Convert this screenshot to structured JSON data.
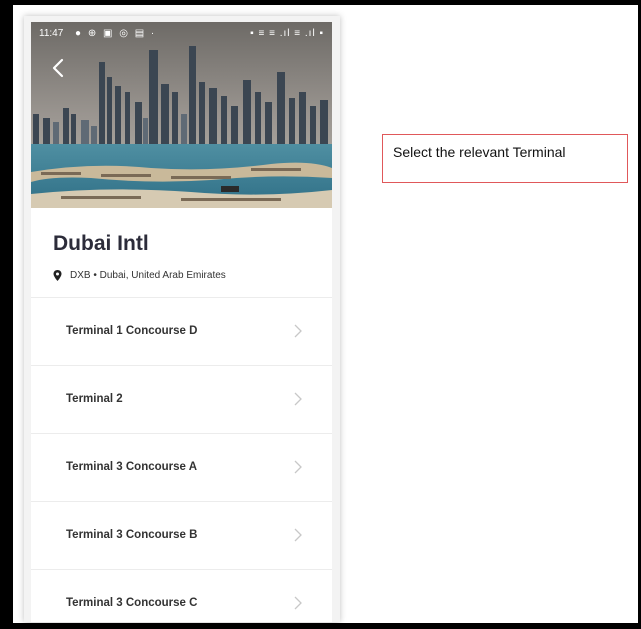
{
  "status_bar": {
    "time": "11:47",
    "left_icons": "● ⊕ ▣ ◎ ▤ ·",
    "right_icons": "▪ ≡ ≡ .ıl ≡ .ıl ▪"
  },
  "airport": {
    "name": "Dubai Intl",
    "location": "DXB • Dubai, United Arab Emirates"
  },
  "terminals": [
    {
      "label": "Terminal 1 Concourse D"
    },
    {
      "label": "Terminal 2"
    },
    {
      "label": "Terminal 3 Concourse A"
    },
    {
      "label": "Terminal 3 Concourse B"
    },
    {
      "label": "Terminal 3 Concourse C"
    }
  ],
  "callout": {
    "text": "Select the relevant Terminal"
  },
  "colors": {
    "callout_border": "#e0585a",
    "title": "#2c2c3a"
  }
}
